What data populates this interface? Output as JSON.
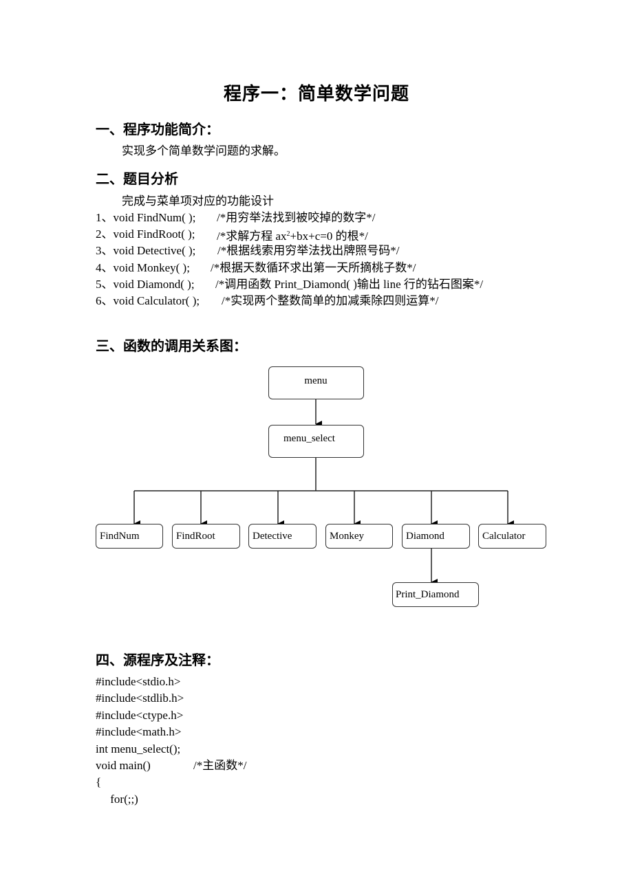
{
  "document": {
    "title": "程序一：简单数学问题",
    "section1": {
      "heading": "一、程序功能简介：",
      "text": "实现多个简单数学问题的求解。"
    },
    "section2": {
      "heading": "二、题目分析",
      "intro": "完成与菜单项对应的功能设计",
      "items": [
        {
          "code": "1、void FindNum( );",
          "comment": "/*用穷举法找到被咬掉的数字*/"
        },
        {
          "code": "2、void FindRoot( );",
          "comment_pre": "/*求解方程 ax",
          "comment_sup": "2",
          "comment_post": "+bx+c=0 的根*/"
        },
        {
          "code": "3、void Detective( );",
          "comment": "/*根据线索用穷举法找出牌照号码*/"
        },
        {
          "code": "4、void Monkey( );",
          "comment": "/*根据天数循环求出第一天所摘桃子数*/"
        },
        {
          "code": "5、void Diamond( );",
          "comment": "/*调用函数 Print_Diamond( )输出 line 行的钻石图案*/"
        },
        {
          "code": "6、void Calculator( );",
          "comment": "/*实现两个整数简单的加减乘除四则运算*/"
        }
      ]
    },
    "section3": {
      "heading": "三、函数的调用关系图：",
      "diagram": {
        "root": "menu",
        "level1": "menu_select",
        "children": [
          "FindNum",
          "FindRoot",
          "Detective",
          "Monkey",
          "Diamond",
          "Calculator"
        ],
        "grandchild": "Print_Diamond"
      }
    },
    "section4": {
      "heading": "四、源程序及注释：",
      "lines": [
        {
          "code": "#include<stdio.h>"
        },
        {
          "code": "#include<stdlib.h>"
        },
        {
          "code": "#include<ctype.h>"
        },
        {
          "code": "#include<math.h>"
        },
        {
          "code": "int menu_select();"
        },
        {
          "code": "void main()",
          "comment": "/*主函数*/"
        },
        {
          "code": "{"
        },
        {
          "code": "     for(;;)"
        }
      ]
    }
  }
}
